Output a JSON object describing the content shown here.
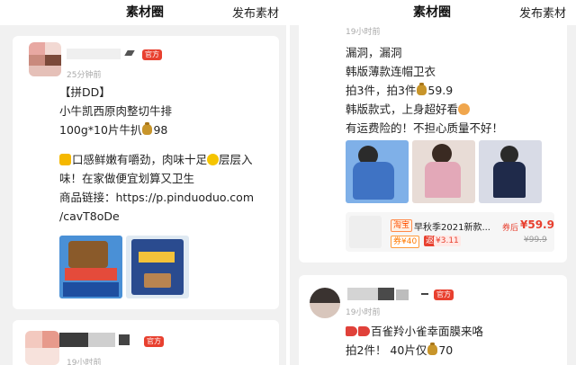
{
  "header": {
    "title": "素材圈",
    "publish_label": "发布素材"
  },
  "left": {
    "post1": {
      "badge": "官方",
      "time": "25分钟前",
      "lines": [
        "【拼DD】",
        "小牛凯西原肉整切牛排",
        "100g*10片牛扒",
        "98",
        "口感鲜嫩有嚼劲，肉味十足",
        "层层入",
        "味！在家做便宜划算又卫生",
        "商品链接：https://p.pinduoduo.com",
        "/cavT8oDe"
      ]
    },
    "post2": {
      "badge": "官方",
      "time": "19小时前"
    }
  },
  "right": {
    "post1": {
      "time": "19小时前",
      "lines": [
        "漏洞，漏洞",
        "韩版薄款连帽卫衣",
        "拍3件，拍3件",
        "59.9",
        "韩版款式，上身超好看",
        "有运费险的！不担心质量不好！"
      ],
      "product": {
        "platform": "淘宝",
        "title": "早秋季2021新款...",
        "coupon_tag": "券¥40",
        "rebate_tag": "返",
        "rebate_value": "¥3.11",
        "price_label": "券后",
        "price": "¥59.9",
        "old_price": "¥99.9"
      }
    },
    "post2": {
      "badge": "官方",
      "time": "19小时前",
      "lines": [
        "百雀羚小雀幸面膜来咯",
        "拍2件！ 40片仅",
        "70"
      ]
    }
  }
}
